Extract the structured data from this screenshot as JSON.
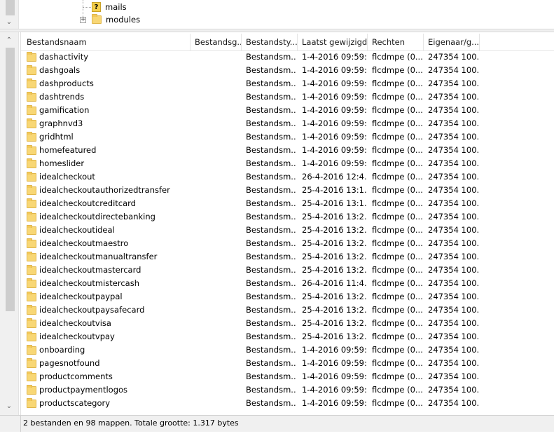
{
  "tree": {
    "items": [
      {
        "label": "mails",
        "icon": "unknown-file-icon"
      },
      {
        "label": "modules",
        "icon": "folder-icon"
      }
    ]
  },
  "list": {
    "columns": [
      "Bestandsnaam",
      "Bestandsg...",
      "Bestandsty...",
      "Laatst gewijzigd",
      "Rechten",
      "Eigenaar/g..."
    ],
    "rows": [
      {
        "name": "dashactivity",
        "type": "Bestandsm...",
        "modified": "1-4-2016 09:59:...",
        "perms": "flcdmpe (0...",
        "owner": "247354 100..."
      },
      {
        "name": "dashgoals",
        "type": "Bestandsm...",
        "modified": "1-4-2016 09:59:...",
        "perms": "flcdmpe (0...",
        "owner": "247354 100..."
      },
      {
        "name": "dashproducts",
        "type": "Bestandsm...",
        "modified": "1-4-2016 09:59:...",
        "perms": "flcdmpe (0...",
        "owner": "247354 100..."
      },
      {
        "name": "dashtrends",
        "type": "Bestandsm...",
        "modified": "1-4-2016 09:59:...",
        "perms": "flcdmpe (0...",
        "owner": "247354 100..."
      },
      {
        "name": "gamification",
        "type": "Bestandsm...",
        "modified": "1-4-2016 09:59:...",
        "perms": "flcdmpe (0...",
        "owner": "247354 100..."
      },
      {
        "name": "graphnvd3",
        "type": "Bestandsm...",
        "modified": "1-4-2016 09:59:...",
        "perms": "flcdmpe (0...",
        "owner": "247354 100..."
      },
      {
        "name": "gridhtml",
        "type": "Bestandsm...",
        "modified": "1-4-2016 09:59:...",
        "perms": "flcdmpe (0...",
        "owner": "247354 100..."
      },
      {
        "name": "homefeatured",
        "type": "Bestandsm...",
        "modified": "1-4-2016 09:59:...",
        "perms": "flcdmpe (0...",
        "owner": "247354 100..."
      },
      {
        "name": "homeslider",
        "type": "Bestandsm...",
        "modified": "1-4-2016 09:59:...",
        "perms": "flcdmpe (0...",
        "owner": "247354 100..."
      },
      {
        "name": "idealcheckout",
        "type": "Bestandsm...",
        "modified": "26-4-2016 12:4...",
        "perms": "flcdmpe (0...",
        "owner": "247354 100..."
      },
      {
        "name": "idealcheckoutauthorizedtransfer",
        "type": "Bestandsm...",
        "modified": "25-4-2016 13:1...",
        "perms": "flcdmpe (0...",
        "owner": "247354 100..."
      },
      {
        "name": "idealcheckoutcreditcard",
        "type": "Bestandsm...",
        "modified": "25-4-2016 13:1...",
        "perms": "flcdmpe (0...",
        "owner": "247354 100..."
      },
      {
        "name": "idealcheckoutdirectebanking",
        "type": "Bestandsm...",
        "modified": "25-4-2016 13:2...",
        "perms": "flcdmpe (0...",
        "owner": "247354 100..."
      },
      {
        "name": "idealcheckoutideal",
        "type": "Bestandsm...",
        "modified": "25-4-2016 13:2...",
        "perms": "flcdmpe (0...",
        "owner": "247354 100..."
      },
      {
        "name": "idealcheckoutmaestro",
        "type": "Bestandsm...",
        "modified": "25-4-2016 13:2...",
        "perms": "flcdmpe (0...",
        "owner": "247354 100..."
      },
      {
        "name": "idealcheckoutmanualtransfer",
        "type": "Bestandsm...",
        "modified": "25-4-2016 13:2...",
        "perms": "flcdmpe (0...",
        "owner": "247354 100..."
      },
      {
        "name": "idealcheckoutmastercard",
        "type": "Bestandsm...",
        "modified": "25-4-2016 13:2...",
        "perms": "flcdmpe (0...",
        "owner": "247354 100..."
      },
      {
        "name": "idealcheckoutmistercash",
        "type": "Bestandsm...",
        "modified": "26-4-2016 11:4...",
        "perms": "flcdmpe (0...",
        "owner": "247354 100..."
      },
      {
        "name": "idealcheckoutpaypal",
        "type": "Bestandsm...",
        "modified": "25-4-2016 13:2...",
        "perms": "flcdmpe (0...",
        "owner": "247354 100..."
      },
      {
        "name": "idealcheckoutpaysafecard",
        "type": "Bestandsm...",
        "modified": "25-4-2016 13:2...",
        "perms": "flcdmpe (0...",
        "owner": "247354 100..."
      },
      {
        "name": "idealcheckoutvisa",
        "type": "Bestandsm...",
        "modified": "25-4-2016 13:2...",
        "perms": "flcdmpe (0...",
        "owner": "247354 100..."
      },
      {
        "name": "idealcheckoutvpay",
        "type": "Bestandsm...",
        "modified": "25-4-2016 13:2...",
        "perms": "flcdmpe (0...",
        "owner": "247354 100..."
      },
      {
        "name": "onboarding",
        "type": "Bestandsm...",
        "modified": "1-4-2016 09:59:...",
        "perms": "flcdmpe (0...",
        "owner": "247354 100..."
      },
      {
        "name": "pagesnotfound",
        "type": "Bestandsm...",
        "modified": "1-4-2016 09:59:...",
        "perms": "flcdmpe (0...",
        "owner": "247354 100..."
      },
      {
        "name": "productcomments",
        "type": "Bestandsm...",
        "modified": "1-4-2016 09:59:...",
        "perms": "flcdmpe (0...",
        "owner": "247354 100..."
      },
      {
        "name": "productpaymentlogos",
        "type": "Bestandsm...",
        "modified": "1-4-2016 09:59:...",
        "perms": "flcdmpe (0...",
        "owner": "247354 100..."
      },
      {
        "name": "productscategory",
        "type": "Bestandsm...",
        "modified": "1-4-2016 09:59:...",
        "perms": "flcdmpe (0...",
        "owner": "247354 100..."
      }
    ]
  },
  "status": {
    "text": "2 bestanden en 98 mappen. Totale grootte: 1.317 bytes"
  },
  "colors": {
    "folder": "#f8d775",
    "scrollbar_bg": "#f0f0f0",
    "scroll_thumb": "#cdcdcd"
  }
}
